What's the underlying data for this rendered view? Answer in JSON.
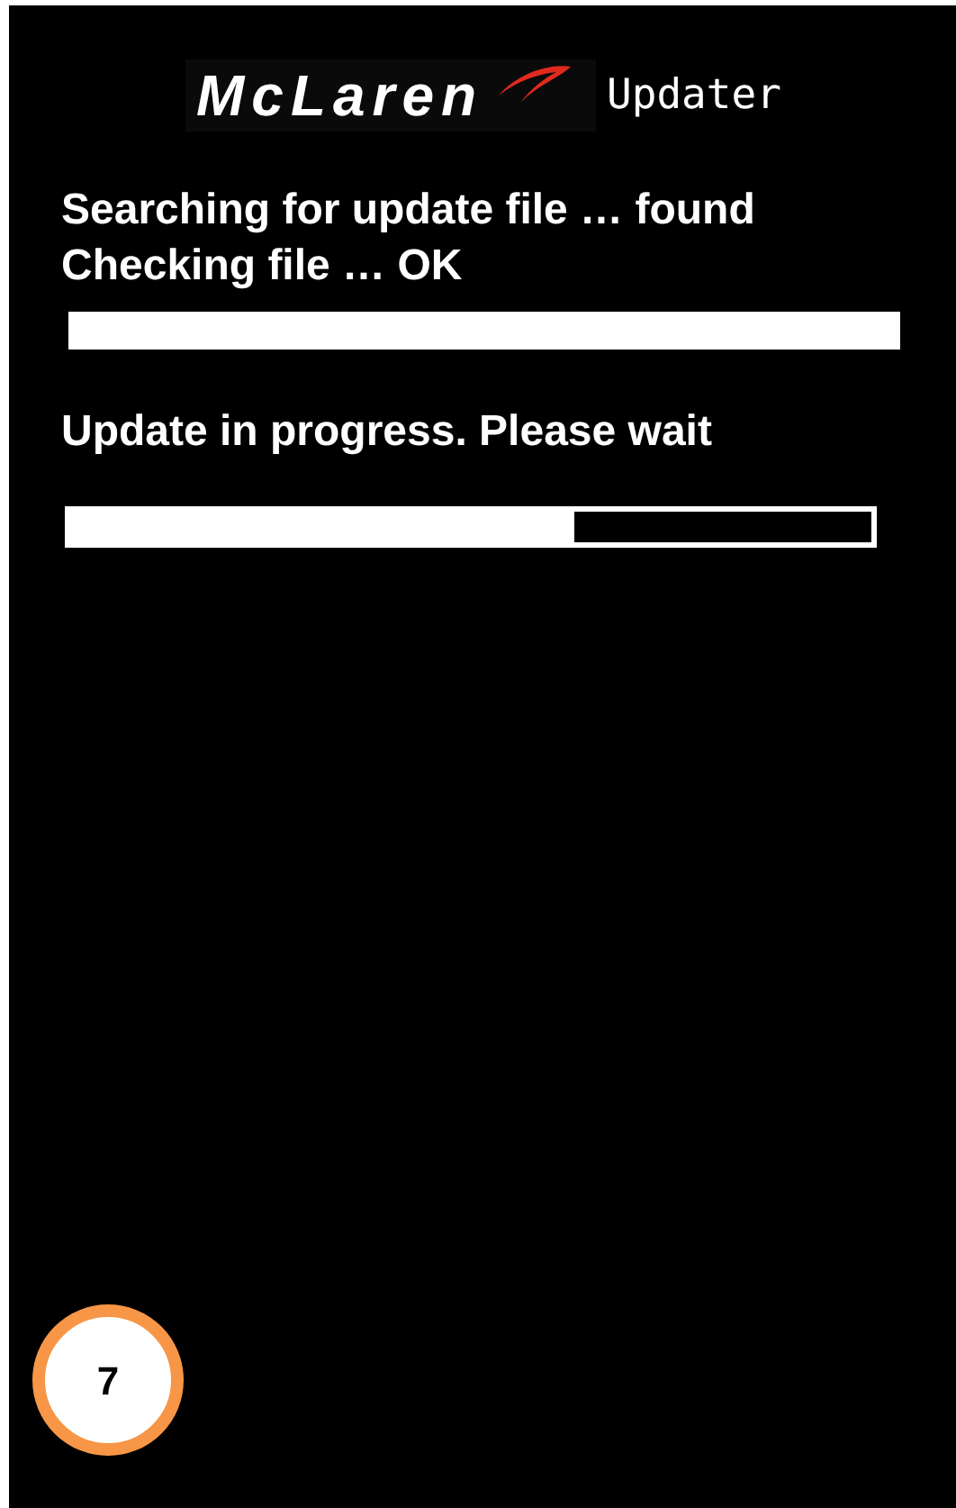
{
  "header": {
    "logo": "McLaren",
    "title": "Updater"
  },
  "steps": [
    {
      "text": "Searching for update file … found"
    },
    {
      "text": "Checking file … OK"
    }
  ],
  "status": "Update in progress. Please wait",
  "update_progress": {
    "level": 0.63
  },
  "step_badge": "7"
}
